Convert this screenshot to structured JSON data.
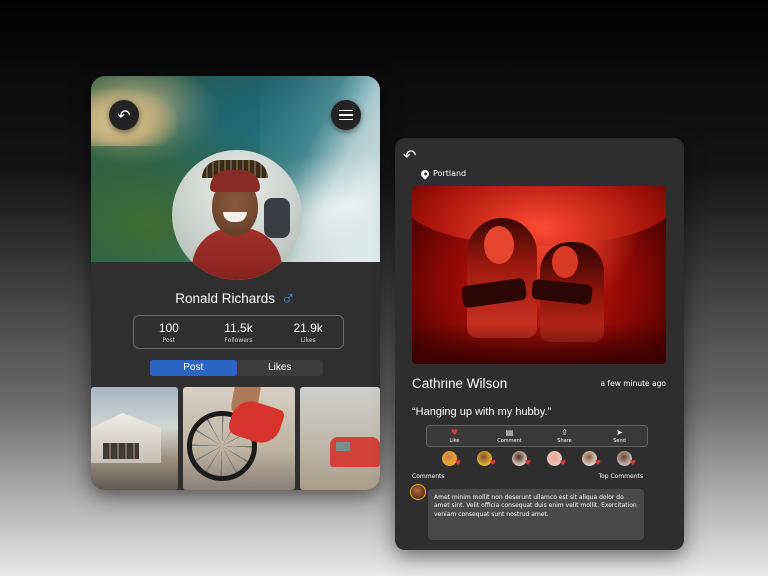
{
  "profile_card": {
    "name": "Ronald Richards",
    "gender_symbol": "♂",
    "stats": [
      {
        "value": "100",
        "label": "Post"
      },
      {
        "value": "11.5k",
        "label": "Followers"
      },
      {
        "value": "21.9k",
        "label": "Likes"
      }
    ],
    "tabs": [
      {
        "label": "Post",
        "active": true
      },
      {
        "label": "Likes",
        "active": false
      }
    ],
    "icons": {
      "back": "back-arrow-icon",
      "menu": "hamburger-menu-icon",
      "gender": "male-symbol-icon"
    }
  },
  "post_card": {
    "location": "Portland",
    "author": "Cathrine Wilson",
    "time": "a few minute ago",
    "caption": "“Hanging up with my hubby.”",
    "actions": [
      {
        "label": "Like",
        "icon": "heart-icon"
      },
      {
        "label": "Comment",
        "icon": "comment-icon"
      },
      {
        "label": "Share",
        "icon": "share-icon"
      },
      {
        "label": "Send",
        "icon": "send-icon"
      }
    ],
    "likers_count_visible": 6,
    "comments_label": "Comments",
    "top_comments_label": "Top Comments",
    "comment_text": "Amet minim mollit non deserunt ullamco est sit aliqua dolor do amet sint. Velit officia consequat duis enim velit mollit. Exercitation veniam consequat sunt nostrud amet."
  },
  "colors": {
    "card_bg": "#302f30",
    "accent_blue": "#2b66c2",
    "male_symbol": "#4a8de0",
    "heart_red": "#e23a3a"
  }
}
